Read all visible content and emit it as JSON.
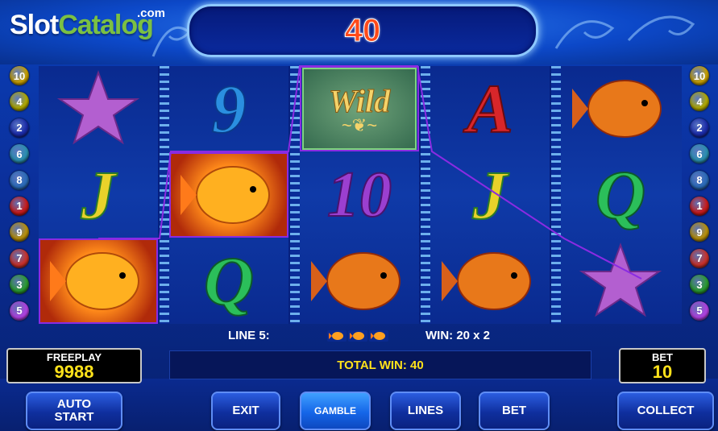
{
  "branding": {
    "logo_part1": "Slot",
    "logo_part2": "Catalog",
    "logo_suffix": ".com"
  },
  "win_display": {
    "value": "40"
  },
  "left_badges": [
    "10",
    "4",
    "2",
    "6",
    "8",
    "1",
    "9",
    "7",
    "3",
    "5"
  ],
  "right_badges": [
    "10",
    "4",
    "2",
    "6",
    "8",
    "1",
    "9",
    "7",
    "3",
    "5"
  ],
  "badge_colors": {
    "10": "#c8a000",
    "4": "#b0a800",
    "2": "#1a2aa8",
    "6": "#2a8fb0",
    "8": "#2a6ab8",
    "1": "#c81a1a",
    "9": "#b8900a",
    "7": "#c8302a",
    "3": "#2a9a30",
    "5": "#b040e0"
  },
  "reels": [
    [
      "starfish",
      "J",
      "fish-glow"
    ],
    [
      "9",
      "fish-glow",
      "Q"
    ],
    [
      "wild",
      "10",
      "fish"
    ],
    [
      "A",
      "J",
      "fish"
    ],
    [
      "fish",
      "Q",
      "starfish"
    ]
  ],
  "wild_label": "Wild",
  "info": {
    "line_label": "LINE 5:",
    "win_label": "WIN: 20 x 2"
  },
  "freeplay": {
    "label": "FREEPLAY",
    "value": "9988"
  },
  "bet_panel": {
    "label": "BET",
    "value": "10"
  },
  "total_win": "TOTAL WIN: 40",
  "buttons": {
    "auto_start": "AUTO\nSTART",
    "exit": "EXIT",
    "gamble": "GAMBLE",
    "lines": "LINES",
    "bet": "BET",
    "collect": "COLLECT"
  },
  "colors": {
    "accent_yellow": "#ffe21a",
    "win_red": "#ff4a1a",
    "payline": "#8a2be2"
  }
}
